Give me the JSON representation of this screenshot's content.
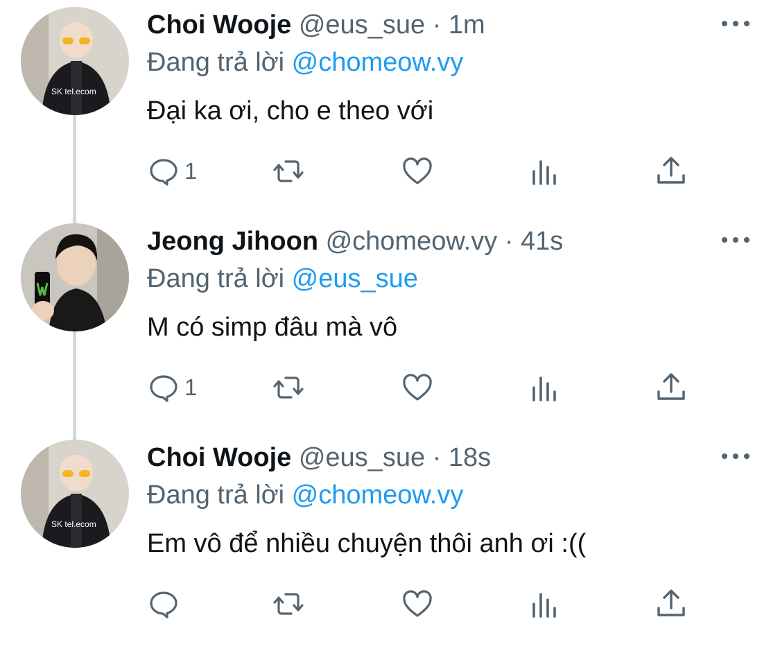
{
  "colors": {
    "text": "#0f1419",
    "secondary": "#536471",
    "link": "#1d9bf0",
    "thread_line": "#cfd9de"
  },
  "replying_label": "Đang trả lời",
  "tweets": [
    {
      "name": "Choi Wooje",
      "handle": "@eus_sue",
      "separator": "·",
      "time": "1m",
      "reply_to": "@chomeow.vy",
      "text": "Đại ka ơi, cho e theo với",
      "reply_count": "1",
      "avatar_icon": "avatar-photo"
    },
    {
      "name": "Jeong Jihoon",
      "handle": "@chomeow.vy",
      "separator": "·",
      "time": "41s",
      "reply_to": "@eus_sue",
      "text": "M có simp đâu mà vô",
      "reply_count": "1",
      "avatar_icon": "avatar-photo"
    },
    {
      "name": "Choi Wooje",
      "handle": "@eus_sue",
      "separator": "·",
      "time": "18s",
      "reply_to": "@chomeow.vy",
      "text": "Em vô để nhiều chuyện thôi anh ơi :((",
      "reply_count": "",
      "avatar_icon": "avatar-photo"
    }
  ],
  "icons": [
    "reply-icon",
    "retweet-icon",
    "like-icon",
    "analytics-icon",
    "share-icon",
    "more-icon"
  ]
}
